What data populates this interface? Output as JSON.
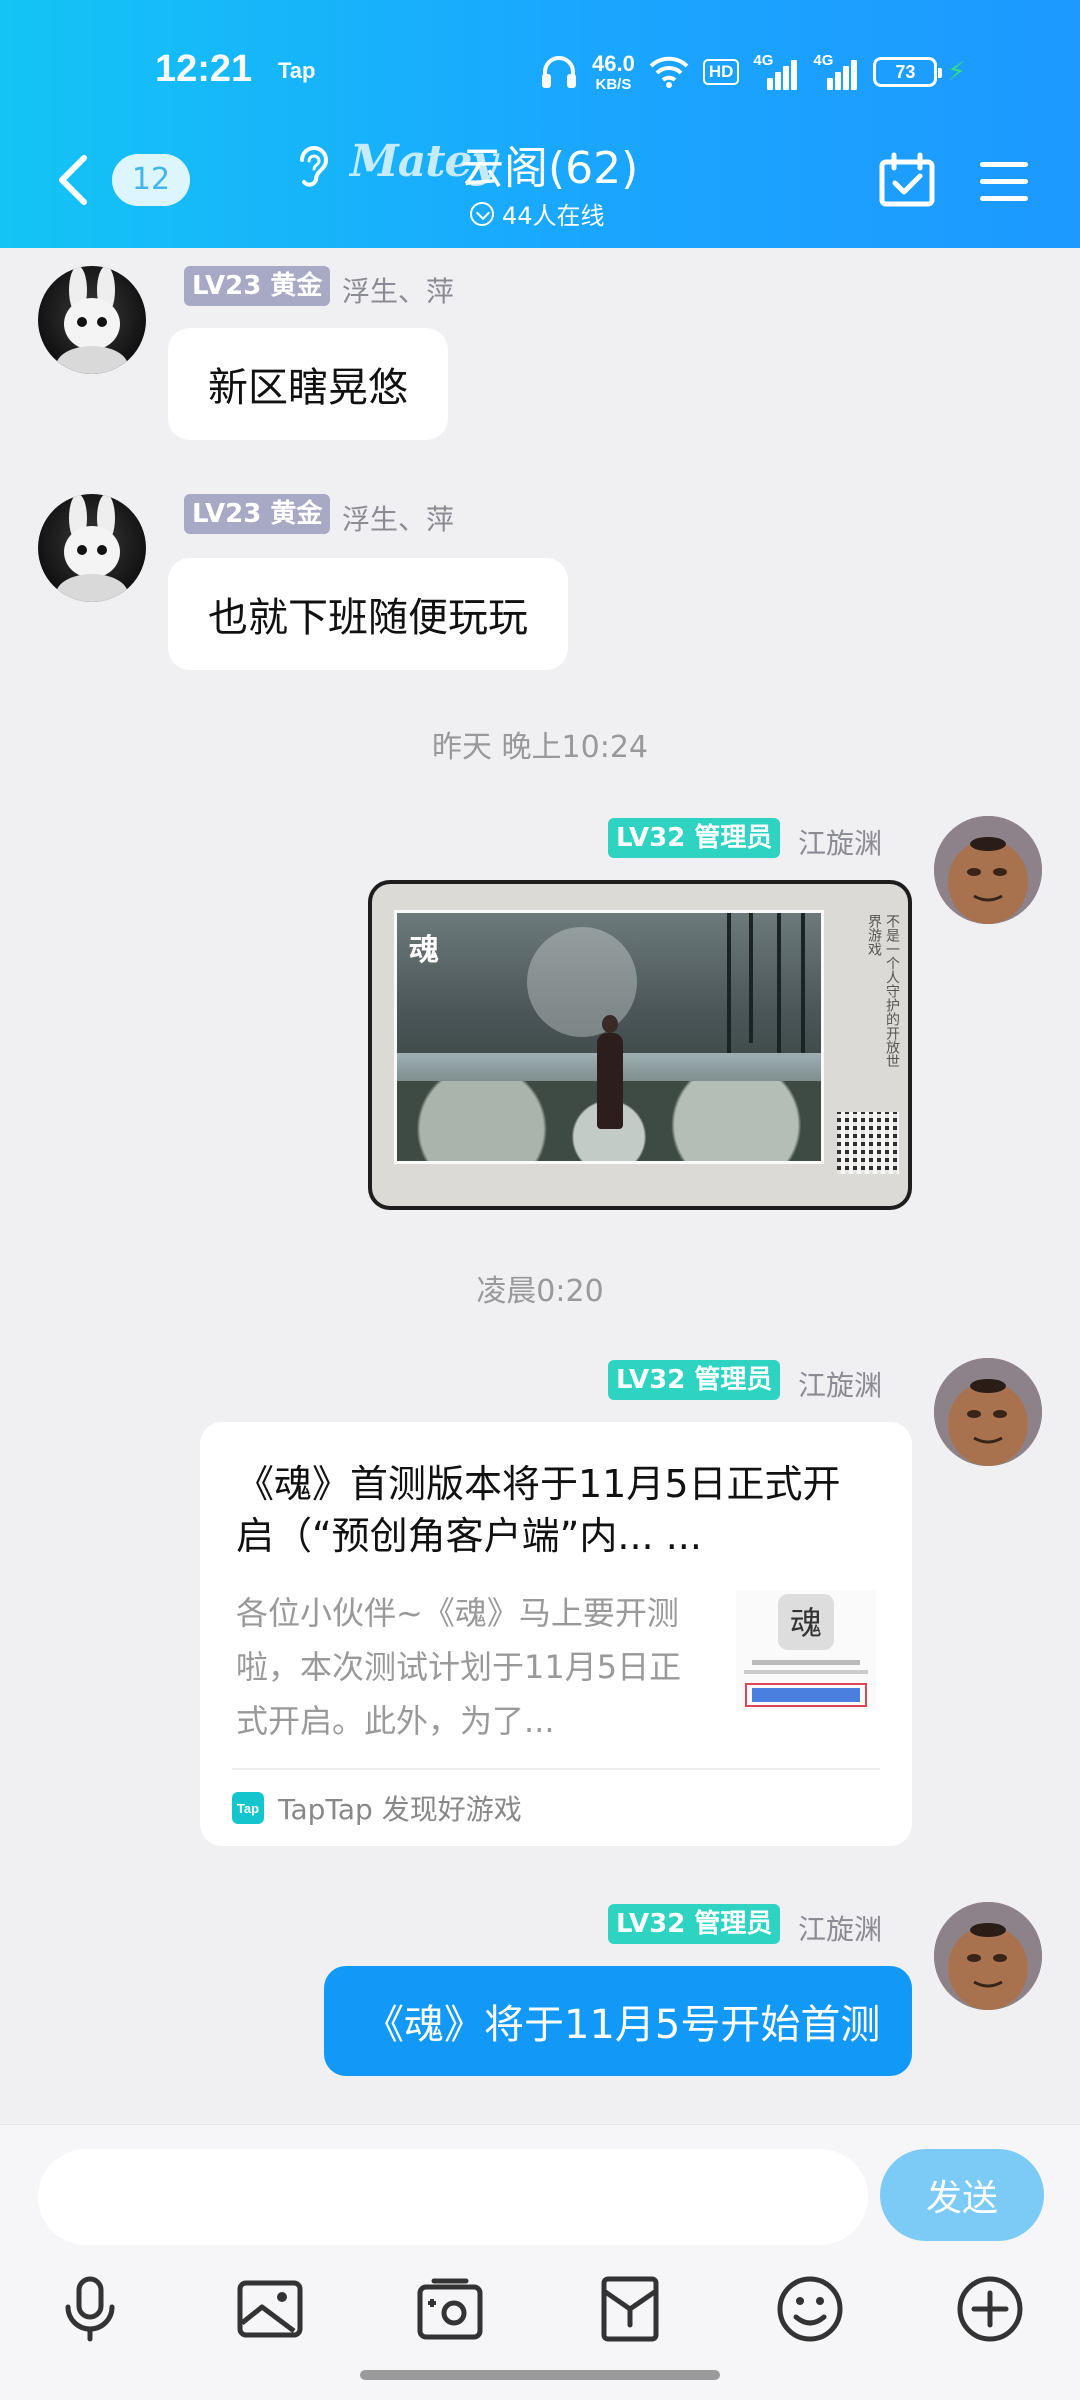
{
  "status_bar": {
    "time": "12:21",
    "carrier": "Tap",
    "net_speed_value": "46.0",
    "net_speed_unit": "KB/S",
    "hd_label": "HD",
    "sim1": "4G",
    "sim2": "4G",
    "battery": "73"
  },
  "header": {
    "unread_count": "12",
    "logo_text": "Matey",
    "group_name": "云阁(62)",
    "online_text": "44人在线"
  },
  "messages": [
    {
      "level": "LV23 黄金",
      "nickname": "浮生、萍",
      "text": "新区瞎晃悠"
    },
    {
      "level": "LV23 黄金",
      "nickname": "浮生、萍",
      "text": "也就下班随便玩玩"
    }
  ],
  "time_separators": [
    "昨天 晚上10:24",
    "凌晨0:20"
  ],
  "admin": {
    "level": "LV32 管理员",
    "nickname": "江旋渊"
  },
  "image_message": {
    "logo_char": "魂",
    "side_text": "不是一个人守护的开放世界游戏"
  },
  "link_card": {
    "title": "《魂》首测版本将于11月5日正式开启（“预创角客户端”内... ...",
    "description": "各位小伙伴~《魂》马上要开测啦，本次测试计划于11月5日正式开启。此外，为了...",
    "source_logo": "Tap",
    "source": "TapTap 发现好游戏"
  },
  "last_message": {
    "text": "《魂》将于11月5号开始首测"
  },
  "input": {
    "placeholder": "",
    "send_label": "发送"
  },
  "colors": {
    "header_gradient_start": "#13c4f5",
    "header_gradient_end": "#1d99ff",
    "gold_badge": "#a8a9c4",
    "admin_badge": "#2ed3c2",
    "sent_bubble": "#1298f6",
    "send_button": "#7ccaf6"
  },
  "toolbar_icons": [
    "microphone-icon",
    "image-icon",
    "camera-icon",
    "gift-icon",
    "emoji-icon",
    "plus-icon"
  ]
}
